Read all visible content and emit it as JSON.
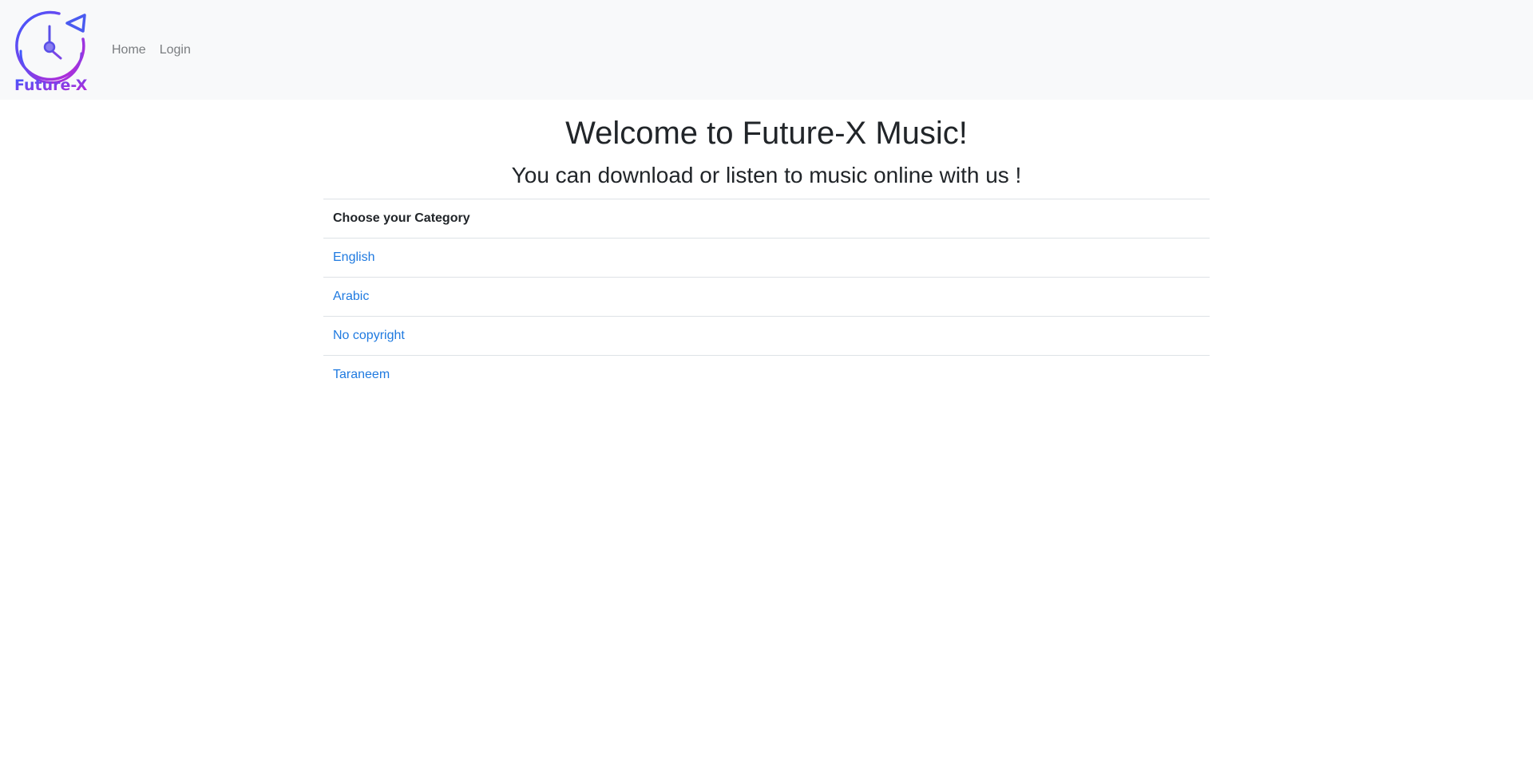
{
  "brand": {
    "logo_text": "Future-X",
    "logo_icon": "music-disc-logo",
    "colors": {
      "gradient_start": "#3d5afe",
      "gradient_end": "#c026d3"
    }
  },
  "nav": {
    "items": [
      {
        "label": "Home"
      },
      {
        "label": "Login"
      }
    ]
  },
  "main": {
    "title": "Welcome to Future-X Music!",
    "subtitle": "You can download or listen to music online with us !"
  },
  "categories": {
    "header": "Choose your Category",
    "items": [
      {
        "label": "English"
      },
      {
        "label": "Arabic"
      },
      {
        "label": "No copyright"
      },
      {
        "label": "Taraneem"
      }
    ]
  },
  "colors": {
    "navbar_bg": "#f8f9fa",
    "link": "#1f7ae0",
    "nav_link": "#7a7d80",
    "border": "#dee2e6",
    "text": "#212529"
  }
}
